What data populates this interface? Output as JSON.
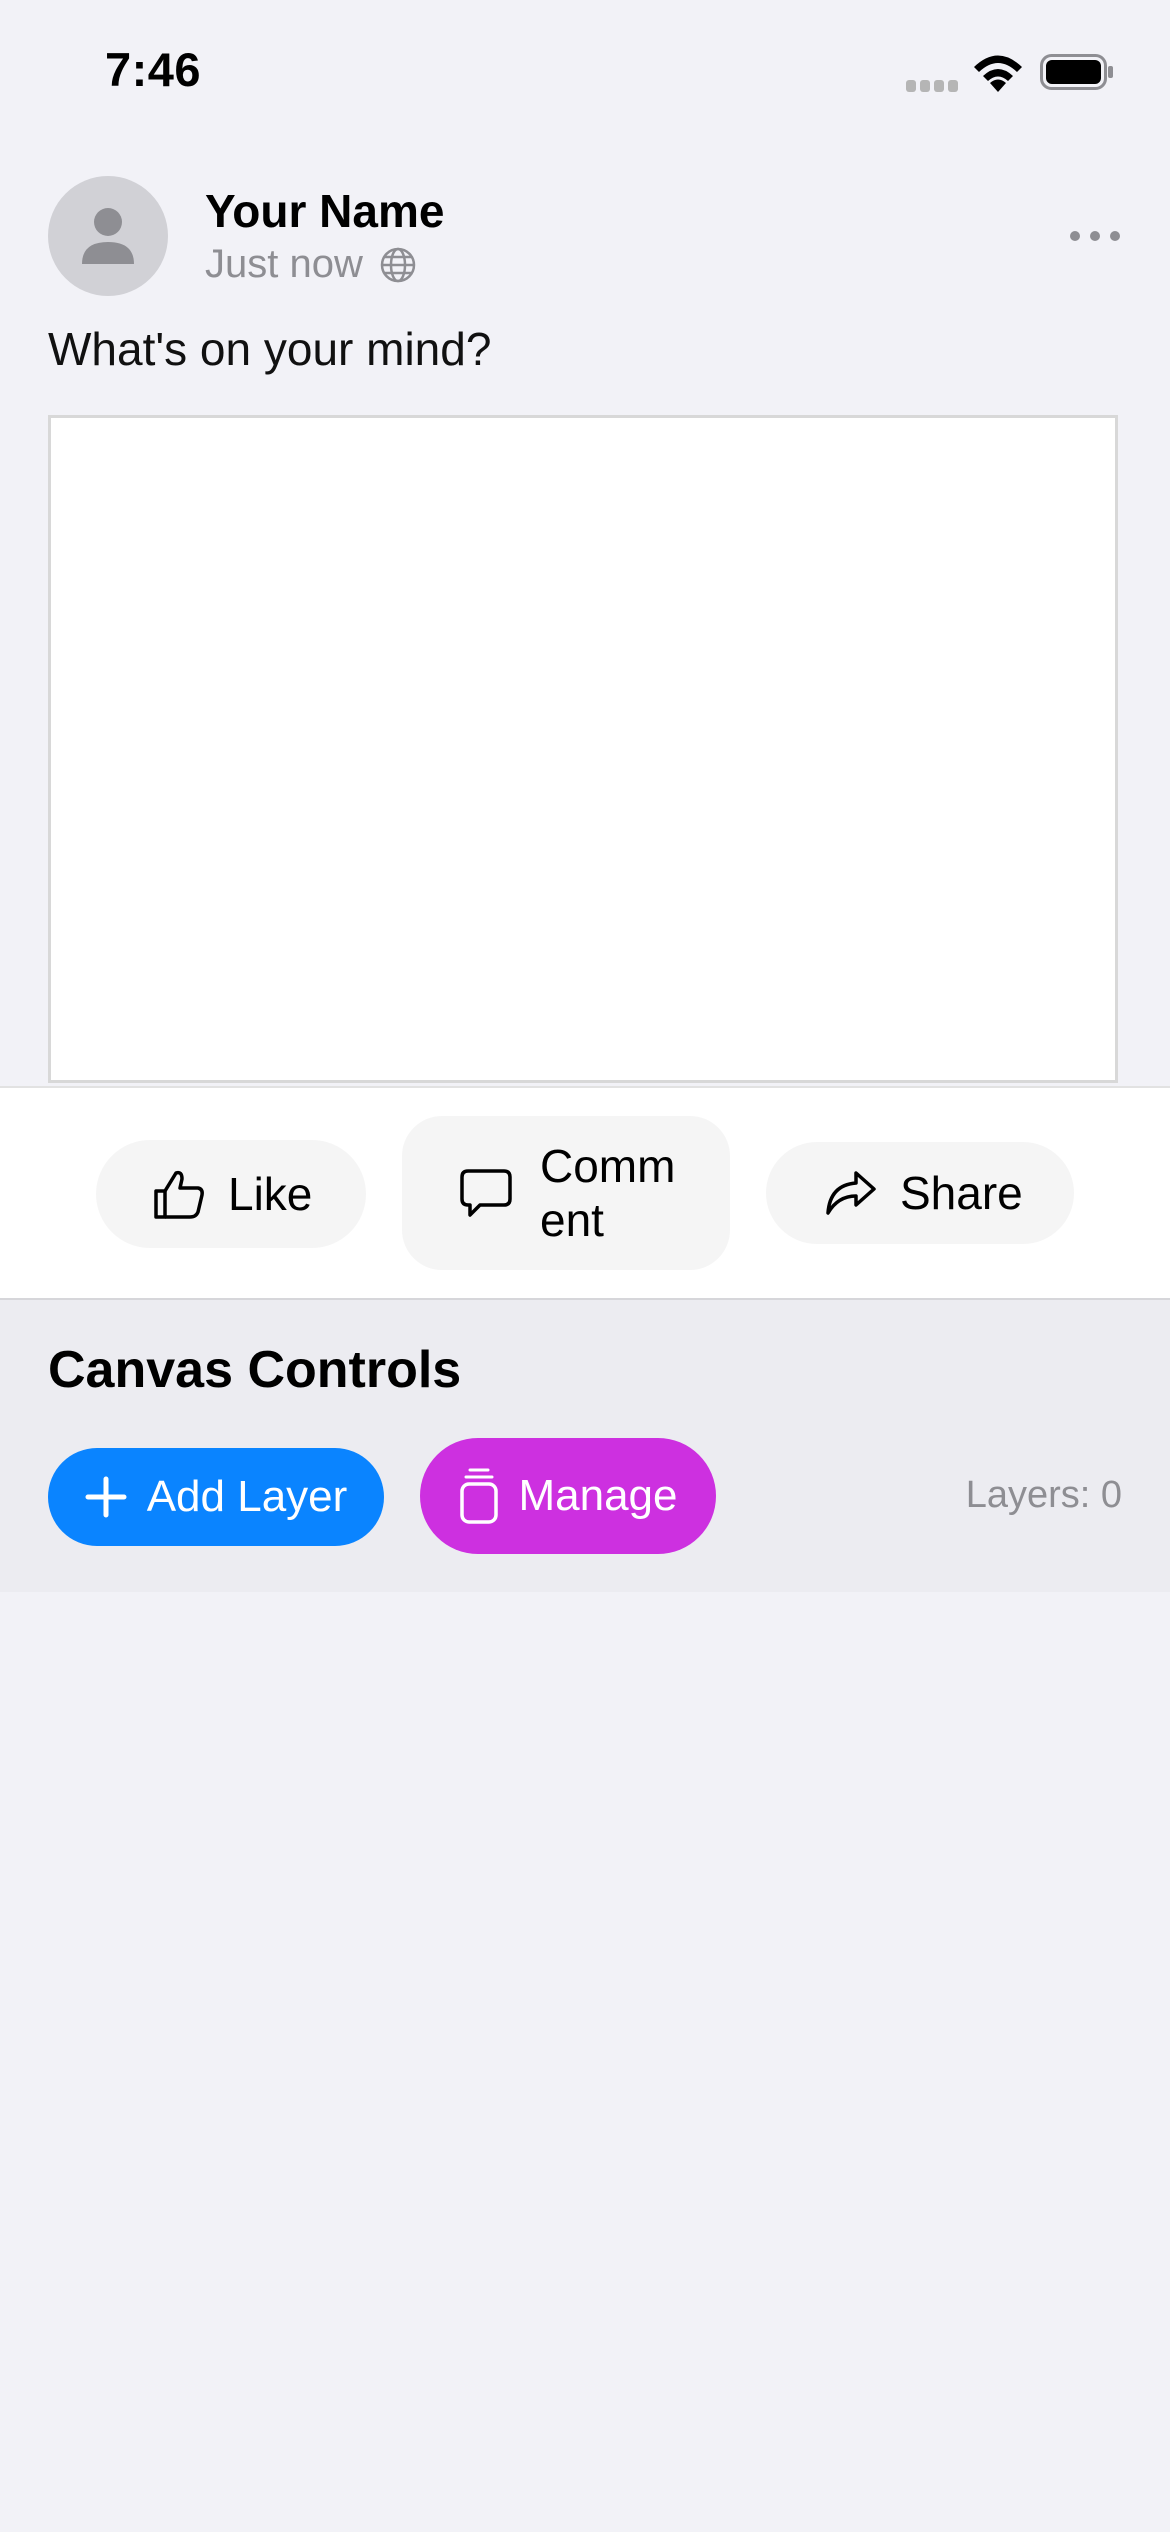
{
  "status_bar": {
    "time": "7:46"
  },
  "post": {
    "author_name": "Your Name",
    "timestamp": "Just now",
    "prompt": "What's on your mind?",
    "privacy_icon": "globe-icon"
  },
  "actions": {
    "like_label": "Like",
    "comment_label": "Comment",
    "share_label": "Share"
  },
  "controls": {
    "title": "Canvas Controls",
    "add_layer_label": "Add Layer",
    "manage_label": "Manage",
    "layer_count": "Layers: 0"
  },
  "colors": {
    "background": "#f2f2f7",
    "add_layer_button": "#0a84ff",
    "manage_button": "#cd30e0",
    "secondary_text": "#8e8e93"
  }
}
